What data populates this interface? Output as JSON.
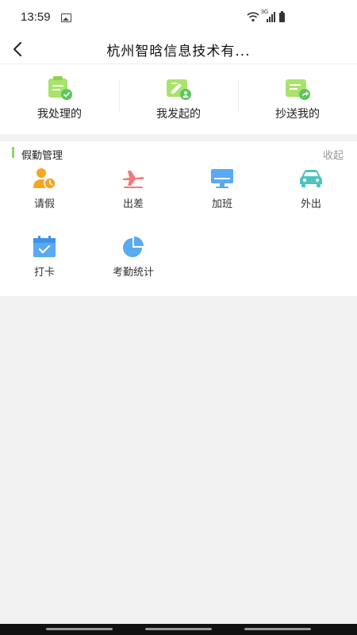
{
  "status_bar": {
    "time": "13:59",
    "network": "3G"
  },
  "header": {
    "title": "杭州智晗信息技术有..."
  },
  "quick_actions": [
    {
      "label": "我处理的",
      "icon": "clipboard-check-icon"
    },
    {
      "label": "我发起的",
      "icon": "edit-user-icon"
    },
    {
      "label": "抄送我的",
      "icon": "forward-share-icon"
    }
  ],
  "section": {
    "title": "假勤管理",
    "collapse_label": "收起",
    "items": [
      {
        "label": "请假",
        "icon": "person-clock-icon"
      },
      {
        "label": "出差",
        "icon": "airplane-icon"
      },
      {
        "label": "加班",
        "icon": "monitor-icon"
      },
      {
        "label": "外出",
        "icon": "car-icon"
      },
      {
        "label": "打卡",
        "icon": "calendar-check-icon"
      },
      {
        "label": "考勤统计",
        "icon": "pie-chart-icon"
      }
    ]
  },
  "colors": {
    "accent_green": "#8bd86a",
    "icon_orange": "#f5a623",
    "icon_red": "#f07a7a",
    "icon_blue": "#5aa9f3",
    "icon_teal": "#4ec3c0"
  }
}
